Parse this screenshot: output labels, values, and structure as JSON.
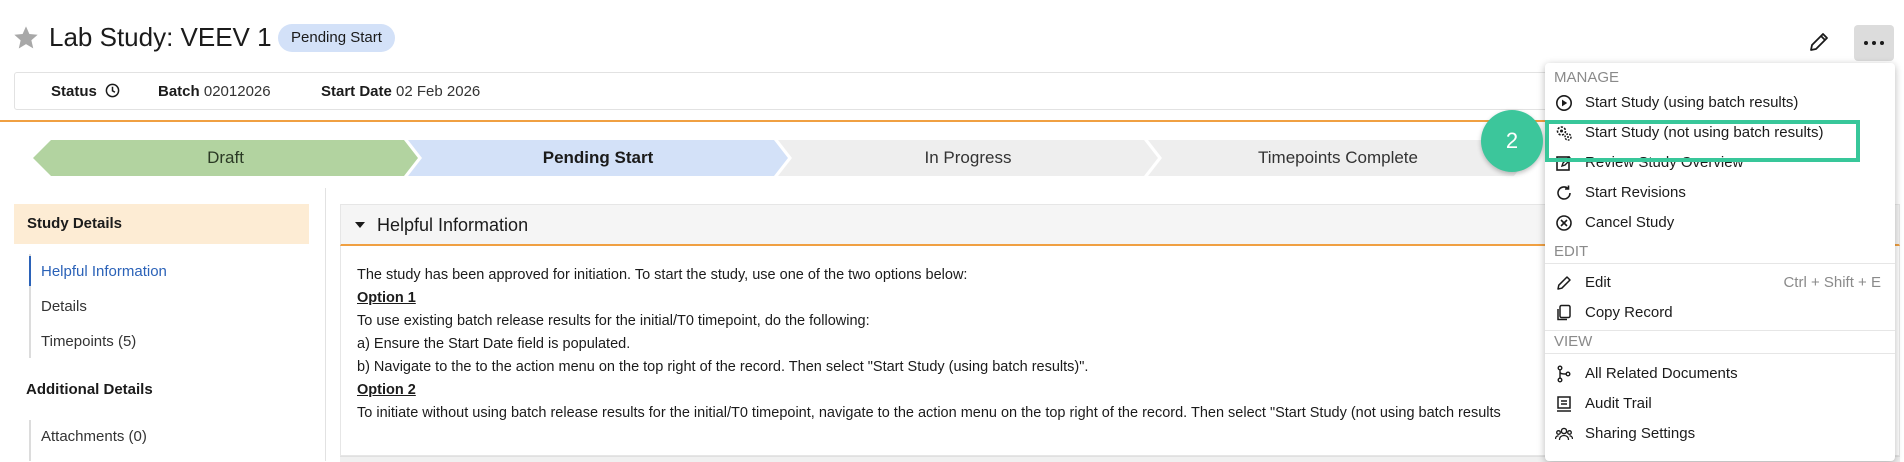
{
  "header": {
    "title": "Lab Study: VEEV 1",
    "status_pill": "Pending Start"
  },
  "info_bar": {
    "status_label": "Status",
    "batch_label": "Batch",
    "batch_value": "02012026",
    "start_date_label": "Start Date",
    "start_date_value": "02 Feb 2026"
  },
  "stages": [
    "Draft",
    "Pending Start",
    "In Progress",
    "Timepoints Complete"
  ],
  "nav": {
    "study_details": "Study Details",
    "items": [
      "Helpful Information",
      "Details",
      "Timepoints (5)"
    ],
    "additional_details": "Additional Details",
    "additional_items": [
      "Attachments (0)"
    ]
  },
  "section": {
    "title": "Helpful Information",
    "lines": [
      "The study has been approved for initiation. To start the study, use one of the two options below:",
      "Option 1",
      "To use existing batch release results for the initial/T0 timepoint, do the following:",
      "a) Ensure the Start Date field is populated.",
      "b) Navigate to the to the action menu on the top right of the record. Then select \"Start Study (using batch results)\".",
      "Option 2",
      "To initiate without using batch release results for the initial/T0 timepoint, navigate to the action menu on the top right of the record. Then select  \"Start Study (not using batch results"
    ]
  },
  "menu": {
    "manage_header": "MANAGE",
    "manage_items": [
      {
        "label": "Start Study (using batch results)",
        "icon": "play-circle-icon"
      },
      {
        "label": "Start Study (not using batch results)",
        "icon": "gears-icon"
      },
      {
        "label": "Review Study Overview",
        "icon": "edit-box-icon"
      },
      {
        "label": "Start Revisions",
        "icon": "refresh-icon"
      },
      {
        "label": "Cancel Study",
        "icon": "cancel-circle-icon"
      }
    ],
    "edit_header": "EDIT",
    "edit_items": [
      {
        "label": "Edit",
        "shortcut": "Ctrl + Shift + E",
        "icon": "pencil-icon"
      },
      {
        "label": "Copy Record",
        "icon": "copy-icon"
      }
    ],
    "view_header": "VIEW",
    "view_items": [
      {
        "label": "All Related Documents",
        "icon": "related-docs-icon"
      },
      {
        "label": "Audit Trail",
        "icon": "audit-trail-icon"
      },
      {
        "label": "Sharing Settings",
        "icon": "sharing-icon"
      }
    ]
  },
  "step_badge": "2",
  "colors": {
    "accent_orange": "#f0a042",
    "pill_blue": "#d3e1f8",
    "draft_green": "#b2d3a0",
    "highlight_green": "#38c79a",
    "link_blue": "#2b62b8"
  }
}
